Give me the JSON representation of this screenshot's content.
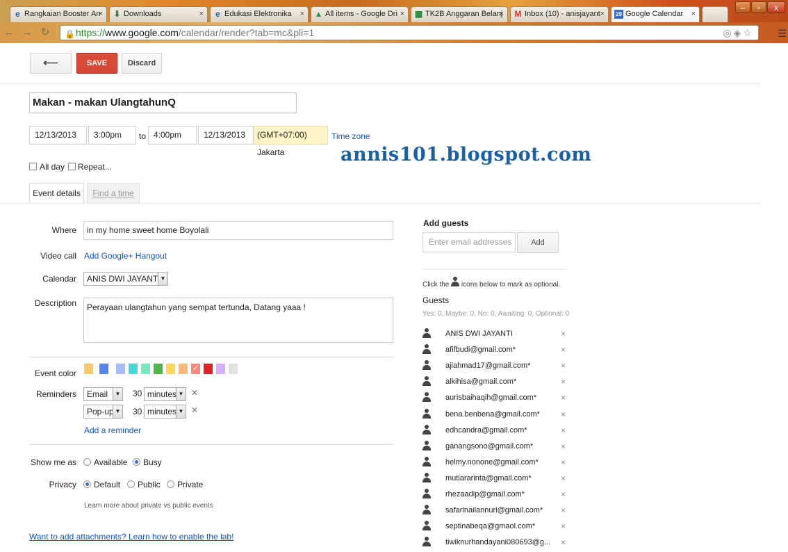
{
  "browser": {
    "tabs": [
      {
        "title": "Rangkaian Booster An",
        "icon": "ie-icon",
        "glyph": "e",
        "color": "#1b5fb3"
      },
      {
        "title": "Downloads",
        "icon": "download-icon",
        "glyph": "⬇",
        "color": "#4a7a3a"
      },
      {
        "title": "Edukasi Elektronika",
        "icon": "ie-icon",
        "glyph": "e",
        "color": "#1b5fb3"
      },
      {
        "title": "All items - Google Dri",
        "icon": "drive-icon",
        "glyph": "▲",
        "color": "#2a9a4a"
      },
      {
        "title": "TK2B Anggaran Belanj",
        "icon": "sheets-icon",
        "glyph": "▦",
        "color": "#1a8a3a"
      },
      {
        "title": "Inbox (10) - anisjayant",
        "icon": "gmail-icon",
        "glyph": "M",
        "color": "#d23a2a"
      },
      {
        "title": "Google Calendar",
        "icon": "calendar-icon",
        "glyph": "29",
        "color": "#3a6fd0"
      }
    ],
    "url_prefix": "https://",
    "url_host": "www.google.com",
    "url_path": "/calendar/render?tab=mc&pli=1"
  },
  "actions": {
    "back": "⟵",
    "save": "SAVE",
    "discard": "Discard"
  },
  "event": {
    "title": "Makan - makan UlangtahunQ",
    "start_date": "12/13/2013",
    "start_time": "3:00pm",
    "to": "to",
    "end_time": "4:00pm",
    "end_date": "12/13/2013",
    "timezone": "(GMT+07:00) Jakarta",
    "timezone_link": "Time zone",
    "all_day": "All day",
    "repeat": "Repeat..."
  },
  "watermark": "annis101.blogspot.com",
  "tabs": {
    "details": "Event details",
    "find_time": "Find a time"
  },
  "details": {
    "where_label": "Where",
    "where_value": "in my home sweet home Boyolali",
    "video_label": "Video call",
    "video_link": "Add Google+ Hangout",
    "calendar_label": "Calendar",
    "calendar_value": "ANIS DWI JAYANTI",
    "description_label": "Description",
    "description_value": "Perayaan ulangtahun yang sempat tertunda, Datang yaaa !",
    "color_label": "Event color",
    "colors": [
      "#f9c86b",
      "#5484ed",
      "#a4bdfc",
      "#46d6db",
      "#7ae7bf",
      "#51b749",
      "#fbd75b",
      "#ffb878",
      "#ff887c",
      "#dc2127",
      "#dbadff",
      "#e1e1e1"
    ],
    "reminders_label": "Reminders",
    "reminders": [
      {
        "method": "Email",
        "value": "30",
        "unit": "minutes"
      },
      {
        "method": "Pop-up",
        "value": "30",
        "unit": "minutes"
      }
    ],
    "add_reminder": "Add a reminder",
    "show_as_label": "Show me as",
    "available": "Available",
    "busy": "Busy",
    "privacy_label": "Privacy",
    "default": "Default",
    "public": "Public",
    "private": "Private",
    "privacy_help": "Learn more about private vs public events",
    "attachments": "Want to add attachments? Learn how to enable the lab!"
  },
  "guests_panel": {
    "title": "Add guests",
    "placeholder": "Enter email addresses",
    "add": "Add",
    "hint_before": "Click the",
    "hint_after": "icons below to mark as optional.",
    "guests_title": "Guests",
    "summary": "Yes: 0, Maybe: 0, No: 0, Awaiting: 0, Optional: 0",
    "guests": [
      "ANIS DWI JAYANTI",
      "afifbudi@gmail.com*",
      "ajiahmad17@gmail.com*",
      "alkihisa@gmail.com*",
      "aurisbaihaqih@gmail.com*",
      "bena.benbena@gmail.com*",
      "edhcandra@gmail.com*",
      "ganangsono@gmail.com*",
      "helmy.nonone@gmail.com*",
      "mutiararinta@gmail.com*",
      "rhezaadip@gmail.com*",
      "safarinailannuri@gmail.com*",
      "septinabeqa@gmaol.com*",
      "tiwiknurhandayani080693@g..."
    ]
  }
}
